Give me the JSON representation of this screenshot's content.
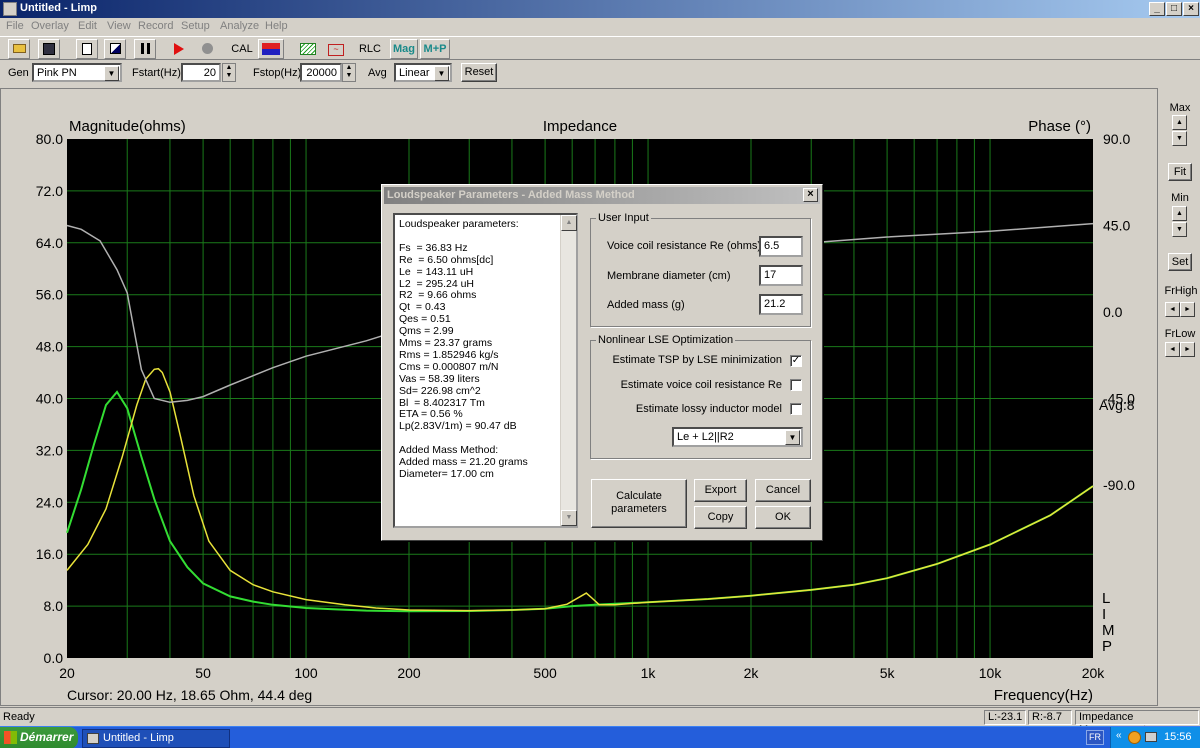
{
  "window": {
    "title": "Untitled - Limp"
  },
  "menu": [
    "File",
    "Overlay",
    "Edit",
    "View",
    "Record",
    "Setup",
    "Analyze",
    "Help"
  ],
  "toolbar": {
    "cal": "CAL",
    "rlc": "RLC",
    "mag": "Mag",
    "mp": "M+P"
  },
  "genbar": {
    "gen_label": "Gen",
    "gen_value": "Pink PN",
    "fstart_label": "Fstart(Hz)",
    "fstart_value": "20",
    "fstop_label": "Fstop(Hz)",
    "fstop_value": "20000",
    "avg_label": "Avg",
    "avg_value": "Linear",
    "reset": "Reset"
  },
  "plot": {
    "title": "Impedance",
    "left_label": "Magnitude(ohms)",
    "right_label": "Phase (°)",
    "x_label": "Frequency(Hz)",
    "cursor": "Cursor: 20.00 Hz, 18.65 Ohm, 44.4 deg",
    "avg": "Avg:8",
    "side_text": [
      "L",
      "I",
      "M",
      "P"
    ]
  },
  "side": {
    "max": "Max",
    "fit": "Fit",
    "min": "Min",
    "set": "Set",
    "frhigh": "FrHigh",
    "frlow": "FrLow"
  },
  "chart_data": {
    "type": "line",
    "title": "Impedance",
    "xlabel": "Frequency(Hz)",
    "ylabel": "Magnitude(ohms)",
    "y2label": "Phase (°)",
    "xscale": "log",
    "xlim": [
      20,
      20000
    ],
    "ylim": [
      0,
      80
    ],
    "y2lim": [
      -180,
      90
    ],
    "x_ticks": [
      "20",
      "50",
      "100",
      "200",
      "500",
      "1k",
      "2k",
      "5k",
      "10k",
      "20k"
    ],
    "y_ticks": [
      "0.0",
      "8.0",
      "16.0",
      "24.0",
      "32.0",
      "40.0",
      "48.0",
      "56.0",
      "64.0",
      "72.0",
      "80.0"
    ],
    "y2_ticks": [
      "90.0",
      "45.0",
      "0.0",
      "-45.0",
      "-90.0"
    ],
    "grid": true,
    "series": [
      {
        "color": "#33dd33",
        "axis": "left",
        "x": [
          20,
          22,
          24,
          26,
          28,
          30,
          33,
          36,
          40,
          45,
          50,
          60,
          70,
          80,
          100,
          120,
          150,
          200,
          300,
          400,
          500,
          600,
          700,
          1000,
          1500,
          2000,
          3000,
          4000,
          5000,
          7000,
          10000,
          15000,
          20000
        ],
        "y": [
          19.3,
          26,
          33,
          39,
          41,
          38.5,
          31,
          24.5,
          18,
          14,
          11.5,
          9.5,
          8.7,
          8.2,
          7.7,
          7.5,
          7.3,
          7.2,
          7.25,
          7.4,
          7.6,
          8.0,
          8.2,
          8.6,
          9.1,
          9.6,
          10.5,
          11.3,
          12.3,
          14.5,
          17.5,
          22,
          26.5
        ]
      },
      {
        "color": "#e8e23a",
        "axis": "left",
        "x": [
          20,
          23,
          26,
          29,
          32,
          34,
          36,
          37,
          38,
          40,
          43,
          47,
          52,
          60,
          70,
          80,
          100,
          130,
          160,
          200,
          300,
          400,
          500,
          580,
          640,
          660,
          680,
          720,
          800,
          1000,
          1500,
          2000,
          3000,
          4000,
          5000,
          7000,
          10000,
          15000,
          20000
        ],
        "y": [
          13.5,
          17.5,
          23,
          31,
          39,
          43,
          44.5,
          44.6,
          44,
          41,
          34,
          25,
          18,
          13.5,
          11.3,
          10.2,
          9,
          8.2,
          7.7,
          7.4,
          7.3,
          7.4,
          7.6,
          8.3,
          9.6,
          10.0,
          9.4,
          8.2,
          8.2,
          8.6,
          9.1,
          9.6,
          10.5,
          11.3,
          12.3,
          14.5,
          17.5,
          22,
          26.5
        ]
      },
      {
        "color": "#b0b0b0",
        "axis": "right",
        "x": [
          20,
          22,
          25,
          28,
          30,
          33,
          36,
          40,
          45,
          50,
          60,
          80,
          100,
          150,
          200,
          300,
          400,
          600,
          1000,
          2000,
          3000,
          5000,
          10000,
          20000
        ],
        "y": [
          45,
          43,
          37,
          22,
          10,
          -30,
          -45,
          -47,
          -46,
          -44,
          -38,
          -29,
          -23,
          -15,
          -8,
          0,
          8,
          19,
          28,
          33,
          36,
          39,
          42,
          46
        ]
      }
    ]
  },
  "dialog": {
    "title": "Loudspeaker Parameters - Added Mass Method",
    "params": [
      "Loudspeaker parameters:",
      "",
      "Fs  = 36.83 Hz",
      "Re  = 6.50 ohms[dc]",
      "Le  = 143.11 uH",
      "L2  = 295.24 uH",
      "R2  = 9.66 ohms",
      "Qt  = 0.43",
      "Qes = 0.51",
      "Qms = 2.99",
      "Mms = 23.37 grams",
      "Rms = 1.852946 kg/s",
      "Cms = 0.000807 m/N",
      "Vas = 58.39 liters",
      "Sd= 226.98 cm^2",
      "Bl  = 8.402317 Tm",
      "ETA = 0.56 %",
      "Lp(2.83V/1m) = 90.47 dB",
      "",
      "Added Mass Method:",
      "Added mass = 21.20 grams",
      "Diameter= 17.00 cm"
    ],
    "user_input": {
      "title": "User Input",
      "re_label": "Voice coil resistance Re (ohms)",
      "re_value": "6.5",
      "diam_label": "Membrane diameter (cm)",
      "diam_value": "17",
      "mass_label": "Added mass (g)",
      "mass_value": "21.2"
    },
    "lse": {
      "title": "Nonlinear LSE Optimization",
      "opt1": "Estimate TSP by LSE minimization",
      "opt1_checked": true,
      "opt2": "Estimate voice coil resistance Re",
      "opt2_checked": false,
      "opt3": "Estimate lossy inductor model",
      "opt3_checked": false,
      "model": "Le + L2||R2"
    },
    "buttons": {
      "calc_line1": "Calculate",
      "calc_line2": "parameters",
      "export": "Export",
      "cancel": "Cancel",
      "copy": "Copy",
      "ok": "OK"
    }
  },
  "status": {
    "ready": "Ready",
    "l": "L:-23.1",
    "r": "R:-8.7",
    "mode": "Impedance Measurement"
  },
  "taskbar": {
    "start": "Démarrer",
    "item": "Untitled - Limp",
    "lang": "FR",
    "time": "15:56"
  }
}
